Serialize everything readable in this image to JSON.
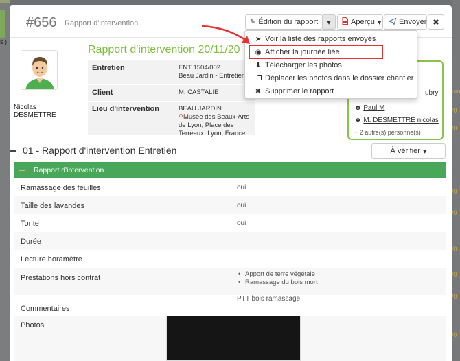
{
  "background": {
    "left_fragment": "s )",
    "right_ticks": [
      "um",
      "/0",
      "/0",
      "/0",
      "/0",
      "/0",
      "/0",
      "/0",
      "/0"
    ]
  },
  "modal": {
    "report_number": "#656",
    "report_subtitle": "Rapport d'intervention",
    "title": "Rapport d'intervention 20/11/20",
    "toolbar": {
      "edit_label": "Édition du rapport",
      "edit_icon": "pencil-square-icon",
      "caret": "▾",
      "preview_label": "Aperçu",
      "preview_icon": "file-pdf-icon",
      "send_label": "Envoyer",
      "send_icon": "paper-plane-icon",
      "close_label": "✖"
    },
    "person": {
      "name_line1": "Nicolas",
      "name_line2": "DESMETTRE"
    },
    "info": [
      {
        "label": "Entretien",
        "value_line1": "ENT   1504/002",
        "value_line2": "Beau Jardin - Entretien"
      },
      {
        "label": "Client",
        "value_line1": "M. CASTALIE",
        "value_line2": ""
      },
      {
        "label": "Lieu d'intervention",
        "value_line1": "BEAU JARDIN",
        "value_line2": "Musée des Beaux-Arts de Lyon, Place des",
        "value_line3": "Terreaux, Lyon, France"
      }
    ],
    "people": {
      "partial": "ubry",
      "p1": "Paul M",
      "p2": "M. DESMETTRE nicolas",
      "more": "+ 2 autre(s) personne(s)"
    },
    "dropdown": [
      {
        "label": "Voir la liste des rapports envoyés",
        "icon": "paper-plane-icon"
      },
      {
        "label": "Afficher la journée liée",
        "icon": "eye-icon"
      },
      {
        "label": "Télécharger les photos",
        "icon": "download-icon"
      },
      {
        "label": "Déplacer les photos dans le dossier chantier",
        "icon": "folder-open-icon"
      },
      {
        "label": "Supprimer le rapport",
        "icon": "times-icon"
      }
    ],
    "section": {
      "title": "01 - Rapport d'intervention Entretien",
      "verify_label": "À vérifier"
    },
    "green_bar_title": "Rapport d'intervention",
    "rows": [
      {
        "label": "Ramassage des feuilles",
        "value": "oui"
      },
      {
        "label": "Taille des lavandes",
        "value": "oui"
      },
      {
        "label": "Tonte",
        "value": "oui"
      },
      {
        "label": "Durée",
        "value": ""
      },
      {
        "label": "Lecture horamètre",
        "value": ""
      },
      {
        "label": "Prestations hors contrat",
        "items": [
          "Apport de terre végétale",
          "Ramassage du bois mort"
        ]
      },
      {
        "label": "Commentaires",
        "value": "PTT bois ramassage"
      },
      {
        "label": "Photos",
        "value": ""
      }
    ],
    "colors": {
      "accent_green": "#7dbf3a",
      "bar_green": "#49a75a",
      "highlight_red": "#e53232"
    }
  }
}
